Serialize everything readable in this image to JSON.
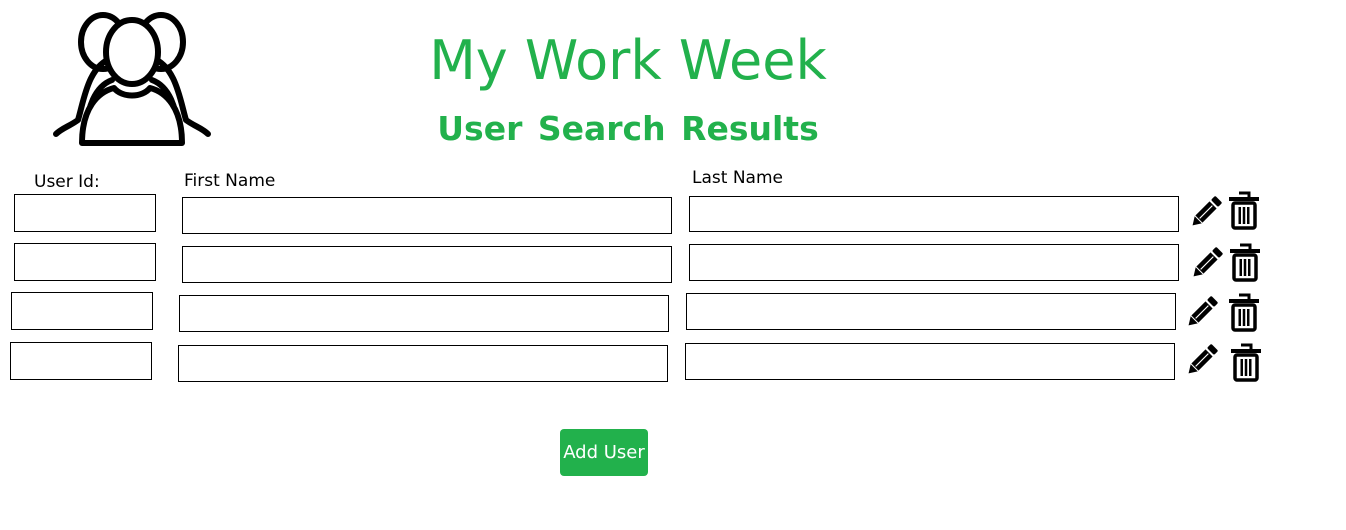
{
  "header": {
    "title": "My Work Week",
    "subtitle": "User Search Results",
    "logo_icon": "users-group-icon"
  },
  "columns": {
    "user_id": "User Id:",
    "first_name": "First Name",
    "last_name": "Last Name"
  },
  "rows": [
    {
      "user_id": "",
      "first_name": "",
      "last_name": ""
    },
    {
      "user_id": "",
      "first_name": "",
      "last_name": ""
    },
    {
      "user_id": "",
      "first_name": "",
      "last_name": ""
    },
    {
      "user_id": "",
      "first_name": "",
      "last_name": ""
    }
  ],
  "row_actions": {
    "edit_icon": "pencil-icon",
    "delete_icon": "trash-icon"
  },
  "add_button": {
    "label": "Add User"
  },
  "colors": {
    "accent": "#22b14c",
    "text": "#000000",
    "background": "#ffffff"
  }
}
